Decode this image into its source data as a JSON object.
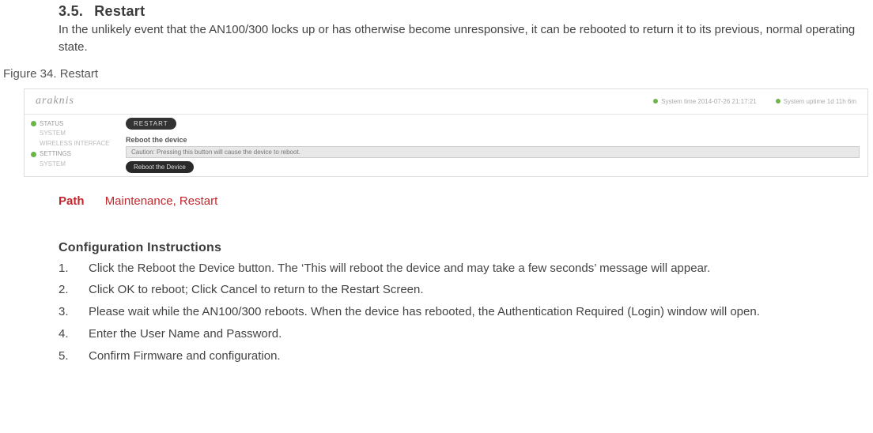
{
  "section": {
    "number": "3.5.",
    "title": "Restart",
    "intro": "In the unlikely event that the AN100/300 locks up or has otherwise become unresponsive, it can be rebooted to return it to its previous, normal operating state."
  },
  "figure_caption": "Figure 34. Restart",
  "screenshot": {
    "logo": "araknis",
    "status_right_1": "System time  2014-07-26 21:17:21",
    "status_right_2": "System uptime  1d 11h 6m",
    "sidebar": {
      "status": "STATUS",
      "status_sub1": "SYSTEM",
      "status_sub2": "WIRELESS INTERFACE",
      "settings": "SETTINGS",
      "settings_sub1": "SYSTEM"
    },
    "main": {
      "pill": "RESTART",
      "section_title": "Reboot the device",
      "banner": "Caution: Pressing this button will cause the device to reboot.",
      "button": "Reboot the Device"
    }
  },
  "path": {
    "label": "Path",
    "value": "Maintenance, Restart"
  },
  "instructions": {
    "heading": "Configuration Instructions",
    "steps": [
      "Click the Reboot the Device button. The ‘This will reboot the device and may take a few seconds’ message will appear.",
      "Click OK to reboot; Click Cancel to return to the Restart Screen.",
      "Please wait while the AN100/300 reboots. When the device has rebooted, the Authentication Required (Login) window will open.",
      "Enter the User Name and Password.",
      "Confirm Firmware and configuration."
    ]
  }
}
